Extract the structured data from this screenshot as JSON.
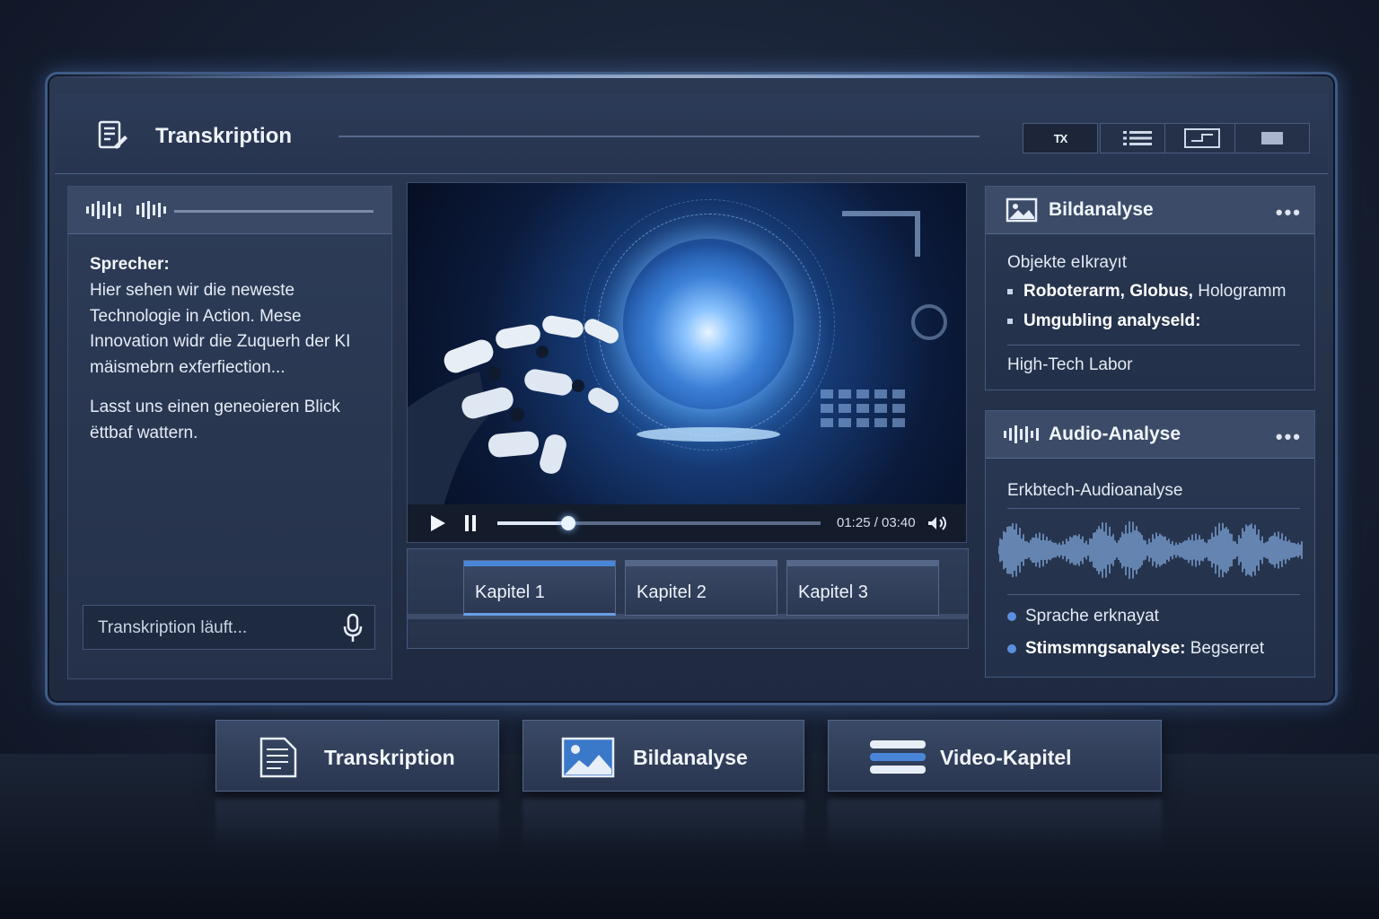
{
  "app": {
    "title": "Transkription",
    "toolbar": [
      {
        "label": "TX",
        "icon": "tx-icon",
        "selected": true
      },
      {
        "label": "",
        "icon": "list-icon",
        "selected": false
      },
      {
        "label": "",
        "icon": "caption-icon",
        "selected": false
      },
      {
        "label": "",
        "icon": "screen-icon",
        "selected": false
      }
    ]
  },
  "transcript": {
    "speaker_label": "Sprecher:",
    "paragraph1": "Hier sehen wir die neweste Technologie in Action. Mese Innovation widr die Zuquerh der KI mäismebrn exferfiection...",
    "paragraph2": "Lasst uns einen geneoieren Blick ëttbaf wattern.",
    "status_text": "Transkription läuft..."
  },
  "video": {
    "time": "01:25 / 03:40",
    "progress": 0.22
  },
  "chapters": [
    {
      "label": "Kapitel 1",
      "active": true
    },
    {
      "label": "Kapitel 2",
      "active": false
    },
    {
      "label": "Kapitel 3",
      "active": false
    }
  ],
  "image_analysis": {
    "title": "Bildanalyse",
    "more": "•••",
    "objects_label": "Objekte eIkrayıt",
    "item1_bold": "Roboterarm, Globus,",
    "item1_rest": " Hologramm",
    "item2_bold": "Umgubling analyseld:",
    "environment": "High-Tech Labor"
  },
  "audio_analysis": {
    "title": "Audio-Analyse",
    "more": "•••",
    "subtitle": "Erkbtech-Audioanalyse",
    "item1": "Sprache erknayat",
    "item2_bold": "Stimsmngsanalyse:",
    "item2_rest": " Begserret"
  },
  "bottom_buttons": [
    {
      "label": "Transkription",
      "icon": "document-icon"
    },
    {
      "label": "Bildanalyse",
      "icon": "image-icon"
    },
    {
      "label": "Video-Kapitel",
      "icon": "layers-icon"
    }
  ],
  "colors": {
    "accent": "#4a86d8",
    "background": "#1a2438",
    "panel": "#2a3853"
  }
}
